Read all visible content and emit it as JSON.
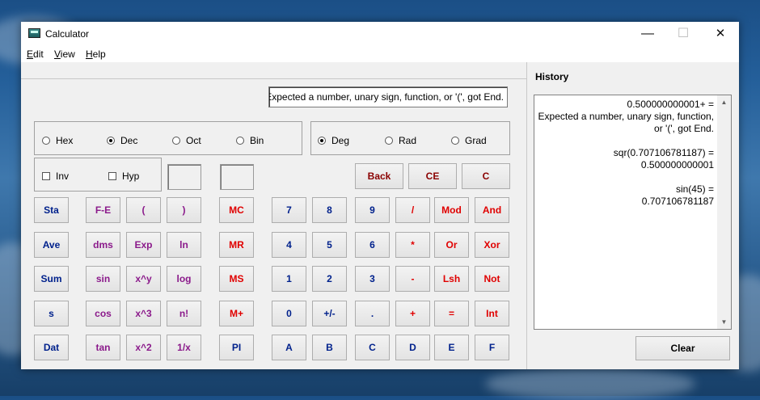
{
  "window": {
    "title": "Calculator",
    "minimize": "—",
    "maximize": "☐",
    "close": "✕"
  },
  "menu": [
    {
      "accel": "E",
      "rest": "dit"
    },
    {
      "accel": "V",
      "rest": "iew"
    },
    {
      "accel": "H",
      "rest": "elp"
    }
  ],
  "display": {
    "value": "Expected a number, unary sign, function, or '(', got End."
  },
  "radix": {
    "options": [
      "Hex",
      "Dec",
      "Oct",
      "Bin"
    ],
    "selected": "Dec"
  },
  "angle": {
    "options": [
      "Deg",
      "Rad",
      "Grad"
    ],
    "selected": "Deg"
  },
  "checks": {
    "inv": "Inv",
    "hyp": "Hyp"
  },
  "buttons": {
    "back": "Back",
    "ce": "CE",
    "c": "C",
    "sta": "Sta",
    "ave": "Ave",
    "sum": "Sum",
    "s": "s",
    "dat": "Dat",
    "fe": "F-E",
    "lparen": "(",
    "rparen": ")",
    "dms": "dms",
    "exp": "Exp",
    "ln": "ln",
    "sin": "sin",
    "xy": "x^y",
    "log": "log",
    "cos": "cos",
    "x3": "x^3",
    "fact": "n!",
    "tan": "tan",
    "x2": "x^2",
    "recip": "1/x",
    "mc": "MC",
    "mr": "MR",
    "ms": "MS",
    "mplus": "M+",
    "pi": "PI",
    "d7": "7",
    "d8": "8",
    "d9": "9",
    "div": "/",
    "mod": "Mod",
    "and": "And",
    "d4": "4",
    "d5": "5",
    "d6": "6",
    "mul": "*",
    "or": "Or",
    "xor": "Xor",
    "d1": "1",
    "d2": "2",
    "d3": "3",
    "sub": "-",
    "lsh": "Lsh",
    "not": "Not",
    "d0": "0",
    "sign": "+/-",
    "dot": ".",
    "add": "+",
    "eq": "=",
    "int": "Int",
    "hA": "A",
    "hB": "B",
    "hC": "C",
    "hD": "D",
    "hE": "E",
    "hF": "F"
  },
  "history": {
    "title": "History",
    "entries": [
      {
        "expr": "0.500000000001+ =",
        "result": "Expected a number, unary sign, function, or '(', got End."
      },
      {
        "expr": "sqr(0.707106781187) =",
        "result": "0.500000000001"
      },
      {
        "expr": "sin(45) =",
        "result": "0.707106781187"
      }
    ],
    "clear": "Clear"
  },
  "colors": {
    "blue": "#00218c",
    "purple": "#8b1a8b",
    "red": "#e00000",
    "dark_red": "#8a0000"
  }
}
